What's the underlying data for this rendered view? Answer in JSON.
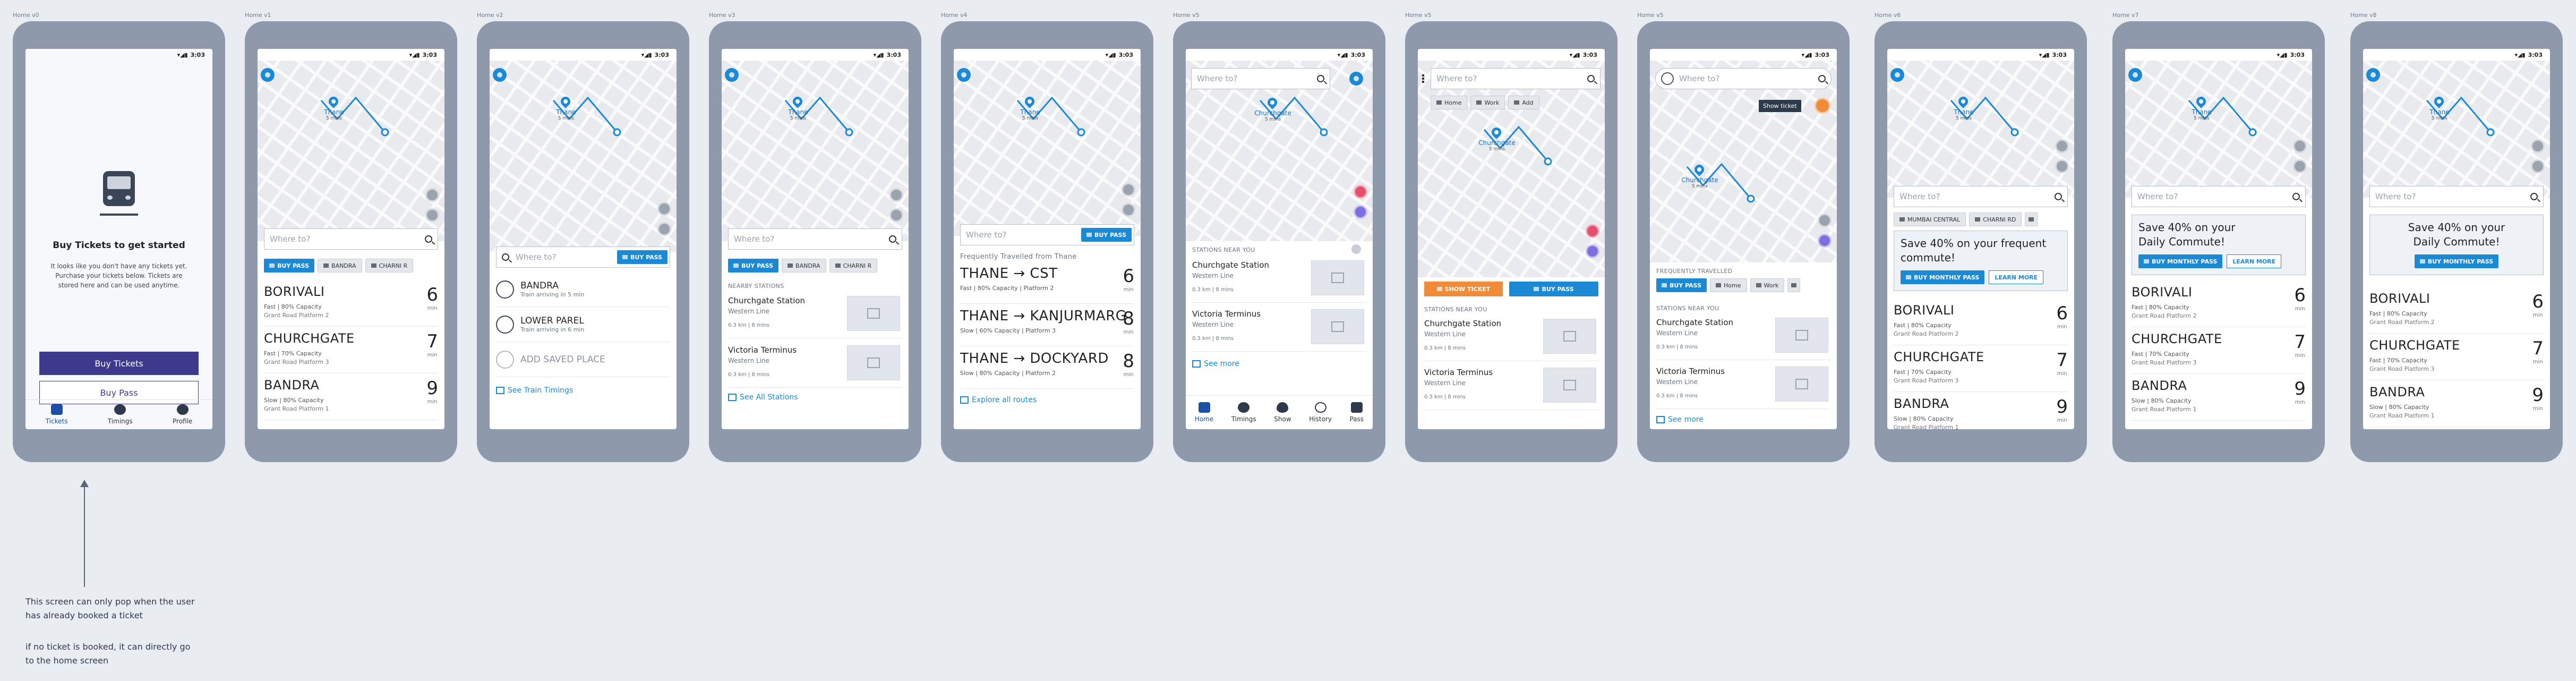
{
  "frames": [
    {
      "label": "Home v0",
      "time": "3:03"
    },
    {
      "label": "Home v1",
      "time": "3:03"
    },
    {
      "label": "Home v2",
      "time": "3:03"
    },
    {
      "label": "Home v3",
      "time": "3:03"
    },
    {
      "label": "Home v4",
      "time": "3:03"
    },
    {
      "label": "Home v5",
      "time": "3:03"
    },
    {
      "label": "Home v5",
      "time": "3:03"
    },
    {
      "label": "Home v5",
      "time": "3:03"
    },
    {
      "label": "Home v6",
      "time": "3:03"
    },
    {
      "label": "Home v7",
      "time": "3:03"
    },
    {
      "label": "Home v8",
      "time": "3:03"
    }
  ],
  "common": {
    "search_placeholder": "Where to?",
    "buy_pass": "BUY PASS",
    "map_thane": "Thane",
    "map_churchgate": "Churchgate",
    "map_eta": "5 mins",
    "chip_bandra": "BANDRA",
    "chip_charni": "CHARNI R",
    "chip_charni_rd": "CHARNI RD",
    "chip_mumbai_central": "MUMBAI CENTRAL",
    "chip_home": "Home",
    "chip_work": "Work",
    "chip_add": "Add",
    "min_label": "min",
    "see_more": "See more",
    "stations_near_you": "STATIONS NEAR YOU",
    "nearby_stations": "NEARBY STATIONS",
    "frequently_travelled": "FREQUENTLY TRAVELLED",
    "show_ticket": "SHOW TICKET",
    "show_ticket_tooltip": "Show ticket",
    "buy_monthly_pass": "BUY MONTHLY PASS",
    "learn_more": "LEARN MORE"
  },
  "empty_state": {
    "title": "Buy Tickets to get started",
    "body": "It looks like you don't have any tickets yet. Purchase your tickets below. Tickets are stored here and can be used anytime.",
    "primary": "Buy Tickets",
    "secondary": "Buy Pass",
    "tabs": [
      "Tickets",
      "Timings",
      "Profile"
    ]
  },
  "trains": [
    {
      "dest": "BORIVALI",
      "info": "Fast | 80% Capacity",
      "plat": "Grant Road Platform 2",
      "mins": "6"
    },
    {
      "dest": "CHURCHGATE",
      "info": "Fast | 70% Capacity",
      "plat": "Grant Road Platform 3",
      "mins": "7"
    },
    {
      "dest": "BANDRA",
      "info": "Slow | 80% Capacity",
      "plat": "Grant Road Platform 1",
      "mins": "9"
    }
  ],
  "saved": [
    {
      "title": "BANDRA",
      "sub": "Train arriving in 5 min"
    },
    {
      "title": "LOWER PAREL",
      "sub": "Train arriving in 6 min"
    },
    {
      "title": "ADD SAVED PLACE",
      "sub": ""
    }
  ],
  "see_train_timings": "See Train Timings",
  "stations": [
    {
      "name": "Churchgate Station",
      "line": "Western Line",
      "dist": "0.3 km | 8 mins"
    },
    {
      "name": "Victoria Terminus",
      "line": "Western Line",
      "dist": "0.3 km | 8 mins"
    }
  ],
  "see_all_stations": "See All Stations",
  "frequent": {
    "title": "Frequently Travelled from Thane",
    "routes": [
      {
        "dest": "THANE → CST",
        "info": "Fast | 80% Capacity | Platform 2",
        "mins": "6"
      },
      {
        "dest": "THANE → KANJURMARG",
        "info": "Slow | 60% Capacity | Platform 3",
        "mins": "8"
      },
      {
        "dest": "THANE → DOCKYARD",
        "info": "Slow | 80% Capacity | Platform 2",
        "mins": "8"
      }
    ],
    "explore": "Explore all routes"
  },
  "v5_tabs": [
    "Home",
    "Timings",
    "Show",
    "History",
    "Pass"
  ],
  "promo_v6": "Save 40% on your frequent commute!",
  "promo_v7": "Save 40% on your Daily Commute!",
  "notes": {
    "n1": "This screen can only pop when the user has already booked a ticket",
    "n2": "if no ticket is booked, it can directly go to the home screen"
  }
}
